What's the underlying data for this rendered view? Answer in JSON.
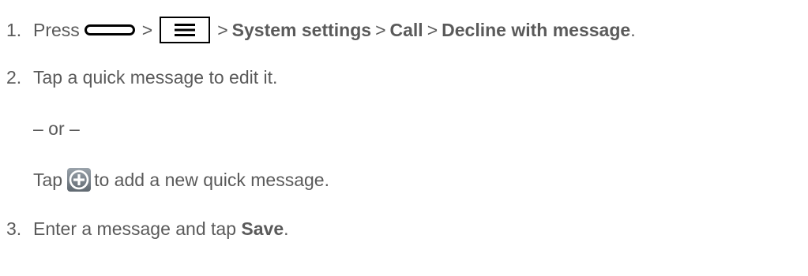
{
  "steps": [
    {
      "number": "1.",
      "press": "Press",
      "gt": ">",
      "path": [
        "System settings",
        "Call",
        "Decline with message"
      ],
      "end": "."
    },
    {
      "number": "2.",
      "text": "Tap a quick message to edit it."
    },
    {
      "number": "3.",
      "text_before": "Enter a message and tap",
      "bold": "Save",
      "end": "."
    }
  ],
  "or_text": "– or –",
  "alt": {
    "tap": "Tap",
    "text": "to add a new quick message."
  },
  "icons": {
    "home": "home-key-icon",
    "menu": "menu-key-icon",
    "add": "plus-circle-icon"
  }
}
